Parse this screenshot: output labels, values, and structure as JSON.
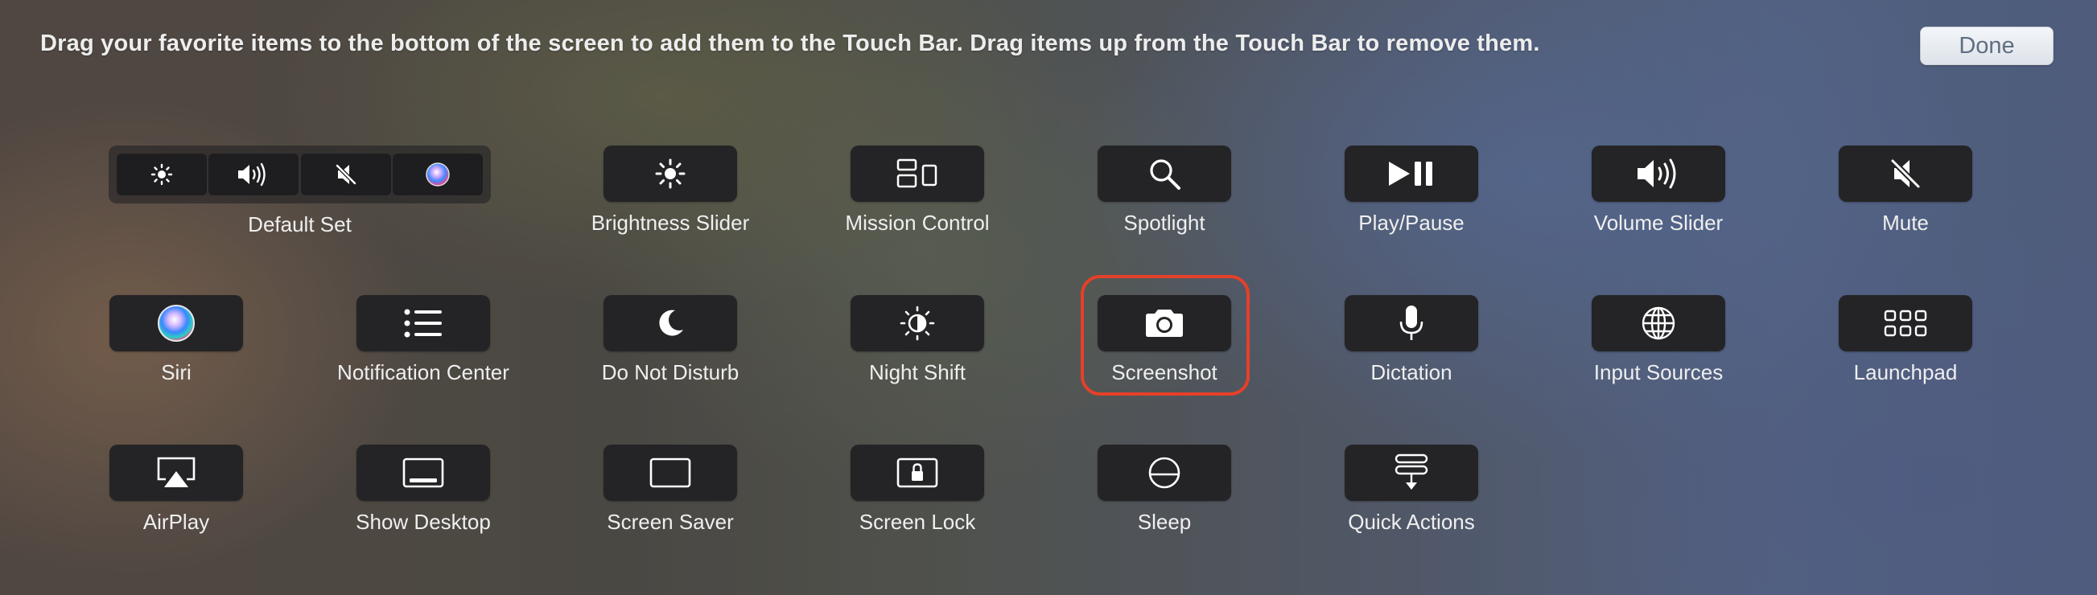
{
  "header": {
    "instruction": "Drag your favorite items to the bottom of the screen to add them to the Touch Bar. Drag items up from the Touch Bar to remove them.",
    "done_label": "Done"
  },
  "default_set": {
    "label": "Default Set",
    "segments": [
      "brightness-icon",
      "volume-icon",
      "mute-icon",
      "siri-icon"
    ]
  },
  "items": {
    "brightness": {
      "label": "Brightness Slider",
      "icon": "brightness-icon"
    },
    "mission_control": {
      "label": "Mission Control",
      "icon": "mission-control-icon"
    },
    "spotlight": {
      "label": "Spotlight",
      "icon": "search-icon"
    },
    "play_pause": {
      "label": "Play/Pause",
      "icon": "play-pause-icon"
    },
    "volume": {
      "label": "Volume Slider",
      "icon": "volume-icon"
    },
    "mute": {
      "label": "Mute",
      "icon": "mute-icon"
    },
    "siri": {
      "label": "Siri",
      "icon": "siri-icon"
    },
    "notification_center": {
      "label": "Notification Center",
      "icon": "list-icon"
    },
    "do_not_disturb": {
      "label": "Do Not Disturb",
      "icon": "moon-icon"
    },
    "night_shift": {
      "label": "Night Shift",
      "icon": "night-shift-icon"
    },
    "screenshot": {
      "label": "Screenshot",
      "icon": "camera-icon"
    },
    "dictation": {
      "label": "Dictation",
      "icon": "microphone-icon"
    },
    "input_sources": {
      "label": "Input Sources",
      "icon": "globe-icon"
    },
    "launchpad": {
      "label": "Launchpad",
      "icon": "grid-icon"
    },
    "airplay": {
      "label": "AirPlay",
      "icon": "airplay-icon"
    },
    "show_desktop": {
      "label": "Show Desktop",
      "icon": "desktop-icon"
    },
    "screen_saver": {
      "label": "Screen Saver",
      "icon": "screen-saver-icon"
    },
    "screen_lock": {
      "label": "Screen Lock",
      "icon": "lock-icon"
    },
    "sleep": {
      "label": "Sleep",
      "icon": "sleep-icon"
    },
    "quick_actions": {
      "label": "Quick Actions",
      "icon": "quick-actions-icon"
    }
  },
  "colors": {
    "highlight": "#e5402a",
    "button_bg": "#242426",
    "label": "#efefef"
  }
}
